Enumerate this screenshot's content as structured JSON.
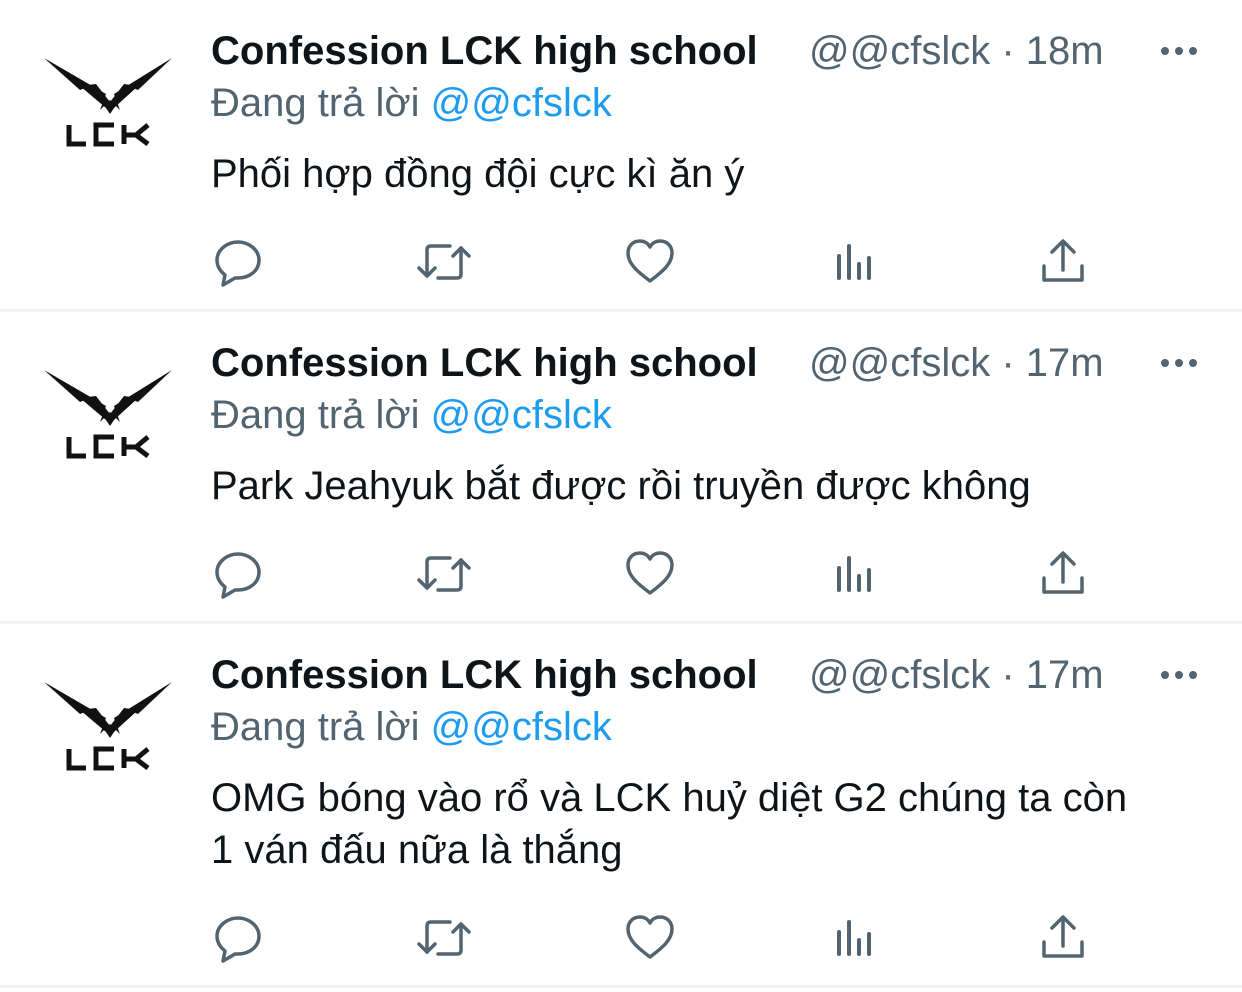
{
  "tweets": [
    {
      "display_name": "Confession LCK high school",
      "handle": "@@cfslck",
      "separator": "·",
      "time": "18m",
      "replying_prefix": "Đang trả lời",
      "replying_to": "@@cfslck",
      "text": "Phối hợp đồng đội cực kì ăn ý"
    },
    {
      "display_name": "Confession LCK high school",
      "handle": "@@cfslck",
      "separator": "·",
      "time": "17m",
      "replying_prefix": "Đang trả lời",
      "replying_to": "@@cfslck",
      "text": "Park Jeahyuk bắt được rồi truyền được không"
    },
    {
      "display_name": "Confession LCK high school",
      "handle": "@@cfslck",
      "separator": "·",
      "time": "17m",
      "replying_prefix": "Đang trả lời",
      "replying_to": "@@cfslck",
      "text": "OMG bóng vào rổ và LCK huỷ diệt G2 chúng ta còn 1 ván đấu nữa là thắng"
    }
  ],
  "avatar_logo_text": "LCK",
  "icons": {
    "more": "more-horizontal-icon",
    "reply": "reply-bubble-icon",
    "retweet": "retweet-icon",
    "like": "heart-icon",
    "analytics": "analytics-bars-icon",
    "share": "share-upload-icon"
  },
  "colors": {
    "text_primary": "#0f1419",
    "text_secondary": "#536471",
    "link": "#1d9bf0",
    "divider": "#eff3f4"
  }
}
